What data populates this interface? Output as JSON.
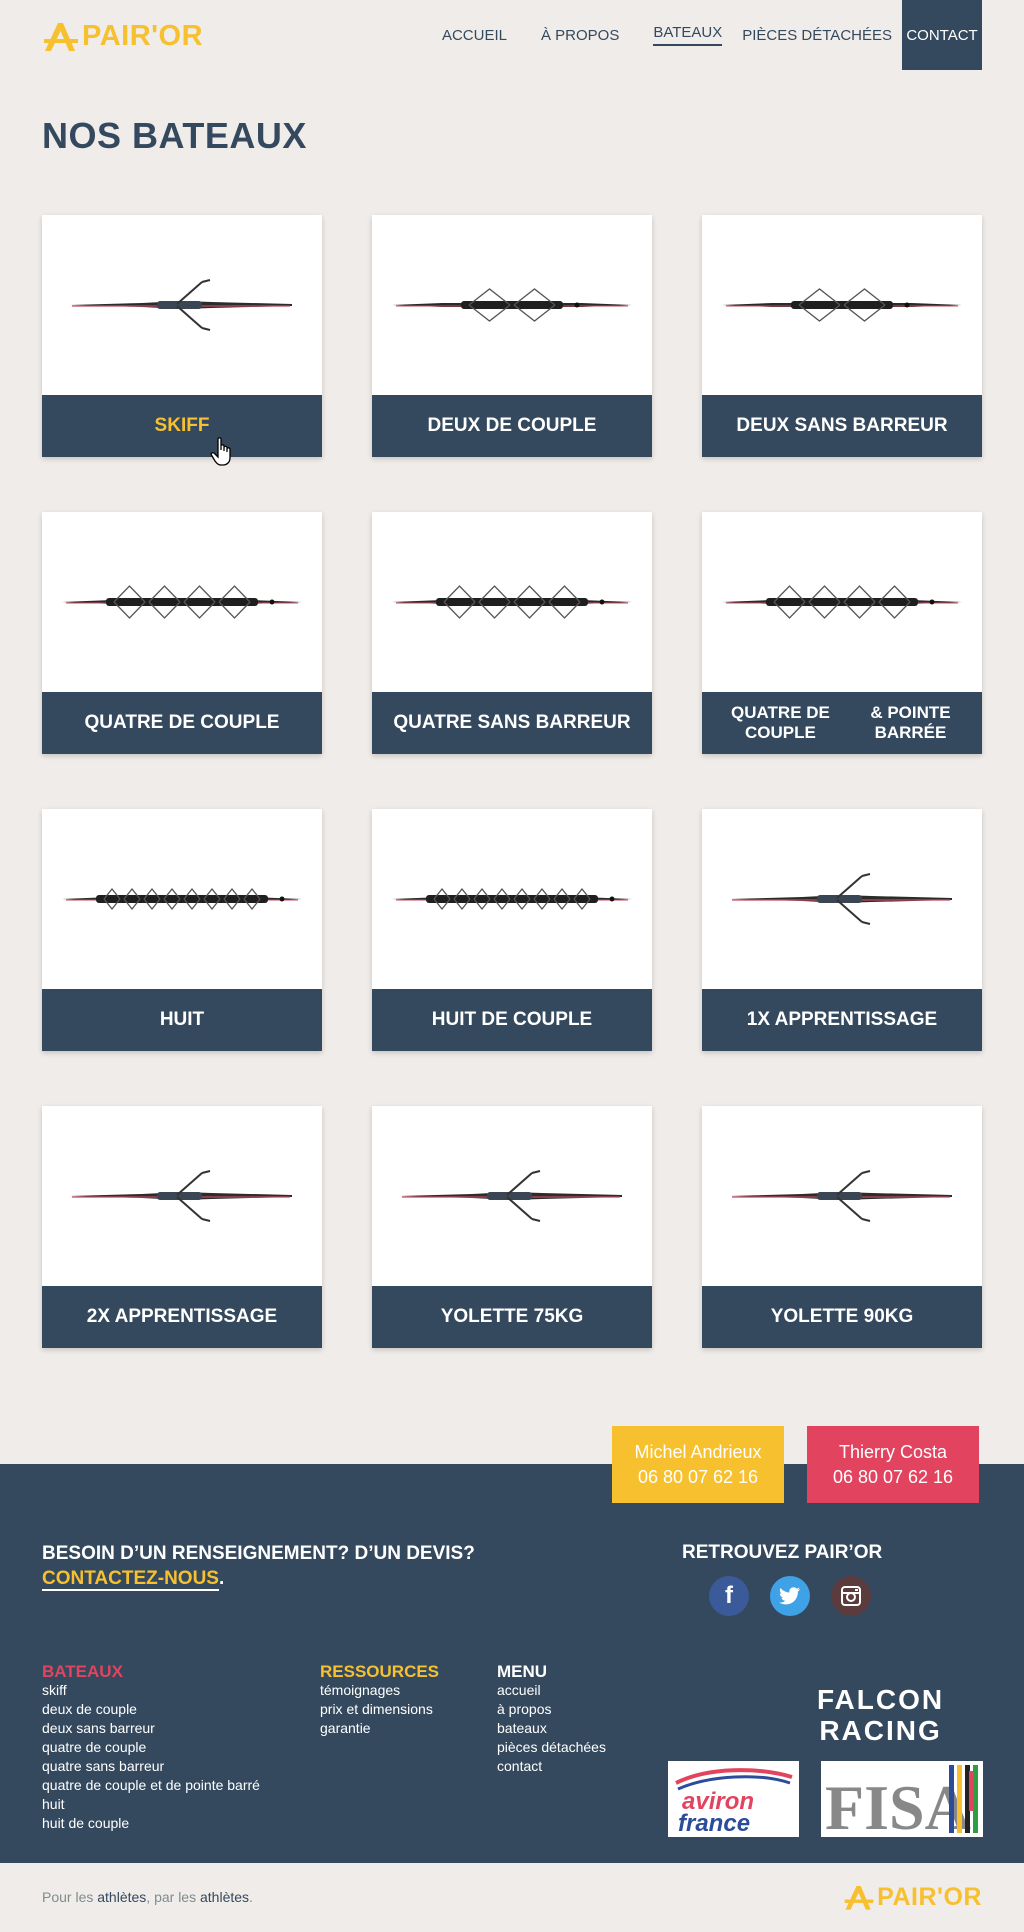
{
  "brand": {
    "name": "PAIR'OR",
    "color": "#f7c02f"
  },
  "nav": {
    "accueil": "ACCUEIL",
    "apropos": "À PROPOS",
    "bateaux": "BATEAUX",
    "pieces": "PIÈCES DÉTACHÉES",
    "contact": "CONTACT"
  },
  "page_title": "NOS BATEAUX",
  "boats": [
    {
      "label": "SKIFF",
      "rowers": 1
    },
    {
      "label": "DEUX DE COUPLE",
      "rowers": 2
    },
    {
      "label": "DEUX SANS BARREUR",
      "rowers": 2
    },
    {
      "label": "QUATRE DE COUPLE",
      "rowers": 4
    },
    {
      "label": "QUATRE SANS BARREUR",
      "rowers": 4
    },
    {
      "label": "QUATRE DE COUPLE & POINTE BARRÉE",
      "label_line1": "QUATRE DE COUPLE",
      "label_line2": "& POINTE BARRÉE",
      "rowers": 4
    },
    {
      "label": "HUIT",
      "rowers": 8
    },
    {
      "label": "HUIT DE COUPLE",
      "rowers": 8
    },
    {
      "label": "1X APPRENTISSAGE",
      "rowers": 1
    },
    {
      "label": "2X APPRENTISSAGE",
      "rowers": 1
    },
    {
      "label": "YOLETTE 75KG",
      "rowers": 1
    },
    {
      "label": "YOLETTE 90KG",
      "rowers": 1
    }
  ],
  "contacts": [
    {
      "name": "Michel Andrieux",
      "phone": "06 80 07 62 16",
      "color": "#f7c02f"
    },
    {
      "name": "Thierry Costa",
      "phone": "06 80 07 62 16",
      "color": "#e2445f"
    }
  ],
  "footer": {
    "question": "BESOIN D’UN RENSEIGNEMENT? D’UN DEVIS?",
    "cta": "CONTACTEZ-NOUS",
    "cta_period": ".",
    "follow": "RETROUVEZ PAIR’OR",
    "socials": [
      "facebook-icon",
      "twitter-icon",
      "instagram-icon"
    ],
    "bateaux": {
      "heading": "BATEAUX",
      "links": [
        "skiff",
        "deux de couple",
        "deux sans barreur",
        "quatre de couple",
        "quatre sans barreur",
        "quatre de couple et de pointe barré",
        "huit",
        "huit de couple"
      ]
    },
    "ressources": {
      "heading": "RESSOURCES",
      "links": [
        "témoignages",
        "prix et dimensions",
        "garantie"
      ]
    },
    "menu": {
      "heading": "MENU",
      "links": [
        "accueil",
        "à propos",
        "bateaux",
        "pièces détachées",
        "contact"
      ]
    },
    "falcon_line1": "FALCON",
    "falcon_line2": "RACING",
    "aviron_line1": "aviron",
    "aviron_line2": "france",
    "fisa": "FISA"
  },
  "tagline": {
    "p1": "Pour les ",
    "a1": "athlètes",
    "p2": ", par les ",
    "a2": "athlètes",
    "p3": "."
  },
  "colors": {
    "navy": "#34495e",
    "yellow": "#f7c02f",
    "red": "#e2445f",
    "bg": "#f0ecea"
  }
}
